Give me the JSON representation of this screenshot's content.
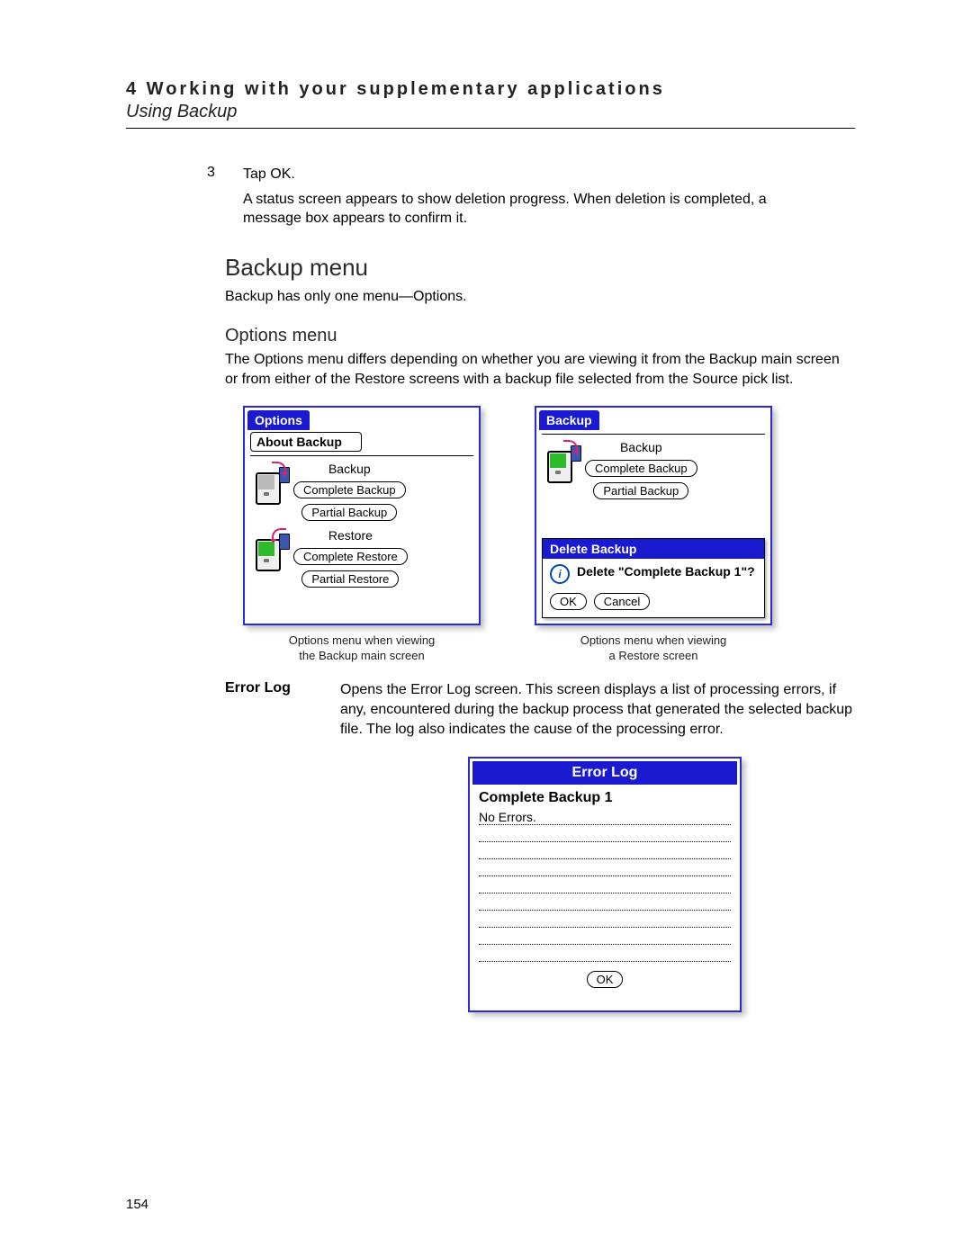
{
  "header": {
    "chapter": "4 Working with your supplementary applications",
    "section": "Using Backup"
  },
  "step": {
    "num": "3",
    "line1": "Tap OK.",
    "line2": "A status screen appears to show deletion progress. When deletion is completed, a message box appears to confirm it."
  },
  "h2": "Backup menu",
  "h2_sub": "Backup has only one menu—Options.",
  "h3": "Options menu",
  "options_para": "The Options menu differs depending on whether you are viewing it from the Backup main screen or from either of the Restore screens with a backup file selected from the Source pick list.",
  "screen_left": {
    "title": "Options",
    "menu_item": "About Backup",
    "backup_label": "Backup",
    "btn_complete_backup": "Complete Backup",
    "btn_partial_backup": "Partial Backup",
    "restore_label": "Restore",
    "btn_complete_restore": "Complete Restore",
    "btn_partial_restore": "Partial Restore",
    "caption_l1": "Options menu when viewing",
    "caption_l2": "the Backup main screen"
  },
  "screen_right": {
    "title": "Backup",
    "backup_label": "Backup",
    "btn_complete_backup": "Complete Backup",
    "btn_partial_backup": "Partial Backup",
    "dlg_title": "Delete Backup",
    "dlg_text": "Delete \"Complete Backup 1\"?",
    "ok": "OK",
    "cancel": "Cancel",
    "caption_l1": "Options menu when viewing",
    "caption_l2": "a Restore screen"
  },
  "errorlog": {
    "term": "Error Log",
    "desc": "Opens the Error Log screen. This screen displays a list of processing errors, if any, encountered during the backup process that generated the selected backup file. The log also indicates the cause of the processing error.",
    "title": "Error Log",
    "subtitle": "Complete Backup 1",
    "line1": "No Errors.",
    "ok": "OK"
  },
  "page_number": "154"
}
